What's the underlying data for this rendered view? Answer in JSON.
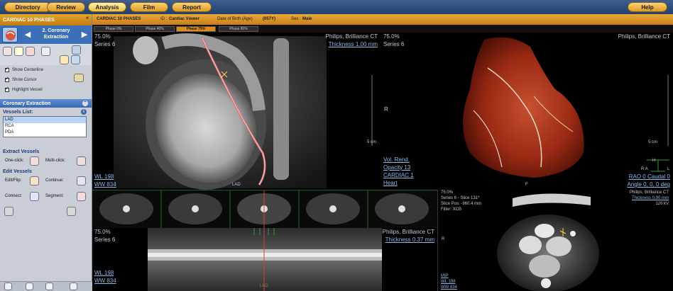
{
  "nav": {
    "directory": "Directory",
    "review": "Review",
    "analysis": "Analysis",
    "film": "Film",
    "report": "Report",
    "help": "Help"
  },
  "left_panel": {
    "header": "CARDIAC 10 PHASES",
    "collapse": "«",
    "step_title": "2. Coronary Extraction",
    "prev_arrow": "◀",
    "next_arrow": "▶",
    "checkboxes": [
      "Show Centerline",
      "Show Cursor",
      "Highlight Vessel"
    ],
    "section": "Coronary Extraction",
    "vessels_label": "Vessels List:",
    "vessels": [
      "LAD",
      "RCA",
      "PDA"
    ],
    "extract_label": "Extract Vessels",
    "one_click": "One-click:",
    "multi_click": "Multi-click:",
    "edit_label": "Edit Vessels",
    "edit_flip": "Edit/Flip:",
    "continue": "Continue:",
    "connect": "Connect:",
    "segment": "Segment:"
  },
  "infobar": {
    "series": "CARDIAC 10 PHASES",
    "id_label": "ID :",
    "id_value": "Cardiac Viewer",
    "dob_label": "Date of Birth (Age)",
    "dob_value": "(057Y)",
    "sex_label": "Sex :",
    "sex_value": "Male"
  },
  "phases": [
    "Phase 0%",
    "Phase 40%",
    "Phase 75%",
    "Phase 80%"
  ],
  "viewports": {
    "sagittal": {
      "pct": "75.0%",
      "series": "Series 6",
      "vendor": "Philips, Brilliance CT",
      "thickness": "Thickness 1.00 mm",
      "wl": "WL   198",
      "ww": "WW  834",
      "vessel_tag": "LAD",
      "scale": "5 cm"
    },
    "vr": {
      "pct": "75.0%",
      "series": "Series 6",
      "vendor": "Philips, Brilliance CT",
      "orient_r": "R",
      "scale": "5 cm",
      "vol_rend": "Vol. Rend.",
      "opacity": "Opacity 13",
      "preset": "CARDIAC 1",
      "organ": "Heart",
      "orient_h": "H",
      "orient_ra": "R   A",
      "orient_l": "L",
      "orient_f": "F",
      "rao": "RAO 0 Caudal 0",
      "angle": "Angle 0, 0, 0  deg"
    },
    "axial": {
      "pct": "75.0%",
      "slice": "Series 6 - Slice 131*",
      "pos": "Slice Pos: -960.4 mm",
      "filter": "Filter: XCB",
      "vendor": "Philips, Brilliance CT",
      "thickness": "Thickness 0.90 mm",
      "kv": "120 kV",
      "orient_r": "R",
      "mode": "MIP",
      "wl": "WL   198",
      "ww": "WW   834"
    },
    "stretched": {
      "pct": "75.0%",
      "series": "Series 6",
      "vendor": "Philips, Brilliance CT",
      "thickness": "Thickness 0.37 mm",
      "wl": "WL   198",
      "ww": "WW   834",
      "vessel_tag": "LAD"
    }
  },
  "colors": {
    "nav_bar": "#21406f",
    "nav_button": "#e09a1e",
    "header_orange": "#c97e16",
    "panel_bg": "#c9ced6",
    "section_blue": "#3a68ad",
    "overlay_text": "#c9c9d6",
    "overlay_link": "#8fb8ea",
    "active_phase": "#e08a1a"
  }
}
